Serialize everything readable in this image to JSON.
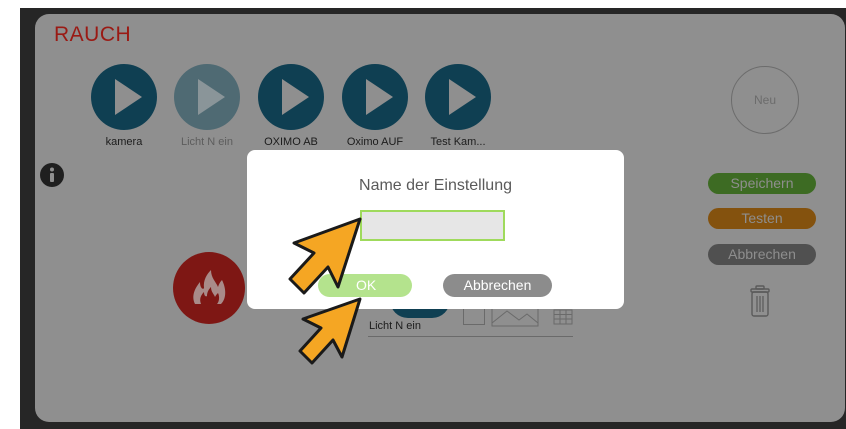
{
  "header": {
    "title": "RAUCH"
  },
  "scenes": [
    {
      "label": "kamera",
      "dimmed": false
    },
    {
      "label": "Licht N ein",
      "dimmed": true
    },
    {
      "label": "OXIMO AB",
      "dimmed": false
    },
    {
      "label": "Oximo AUF",
      "dimmed": false
    },
    {
      "label": "Test Kam...",
      "dimmed": false
    }
  ],
  "side_panel": {
    "new_label": "Neu",
    "save_label": "Speichern",
    "test_label": "Testen",
    "cancel_label": "Abbrechen"
  },
  "background_scene": {
    "label": "Licht N ein"
  },
  "dialog": {
    "title": "Name der Einstellung",
    "input_value": "",
    "ok_label": "OK",
    "cancel_label": "Abbrechen"
  },
  "colors": {
    "title_red": "#9a1a14",
    "scene_blue": "#0f3f52",
    "save_green": "#3d6b23",
    "test_orange": "#84520e",
    "ok_green": "#b4e38d",
    "input_border": "#9fda5c",
    "cursor_orange": "#f5a623"
  },
  "icons": [
    "info-icon",
    "play-icon",
    "fire-icon",
    "trash-icon",
    "image-icon",
    "grid-icon",
    "pointer-cursor-icon"
  ]
}
